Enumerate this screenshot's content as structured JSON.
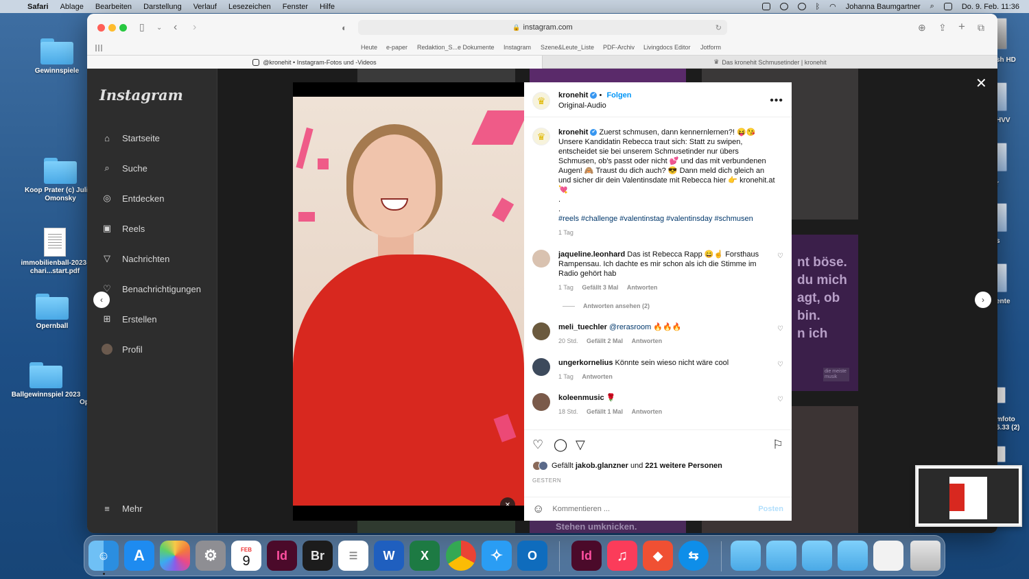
{
  "menubar": {
    "apple": "",
    "items": [
      "Safari",
      "Ablage",
      "Bearbeiten",
      "Darstellung",
      "Verlauf",
      "Lesezeichen",
      "Fenster",
      "Hilfe"
    ],
    "user": "Johanna Baumgartner",
    "clock": "Do. 9. Feb.  11:36"
  },
  "desktop": {
    "icons": [
      "Gewinnspiele",
      "Koop Prater (c) Julian Omonsky",
      "immobilienball-2023-chari...start.pdf",
      "Opernball",
      "Ballgewinnspiel 2023"
    ],
    "side_labels": [
      "sh HD",
      "HVV",
      "r",
      "s",
      "ente",
      "mfoto",
      "6.33 (2)"
    ],
    "partial_label": "Op"
  },
  "browser": {
    "url": "instagram.com",
    "bookmarks": [
      "Heute",
      "e-paper",
      "Redaktion_S...e Dokumente",
      "Instagram",
      "Szene&Leute_Liste",
      "PDF-Archiv",
      "Livingdocs Editor",
      "Jotform"
    ],
    "tab_active": "@kronehit • Instagram-Fotos und -Videos",
    "tab_other": "Das kronehit Schmusetinder | kronehit"
  },
  "instagram": {
    "logo": "Instagram",
    "nav": [
      "Startseite",
      "Suche",
      "Entdecken",
      "Reels",
      "Nachrichten",
      "Benachrichtigungen",
      "Erstellen",
      "Profil"
    ],
    "more": "Mehr",
    "tile_text": "nt böse.\ndu mich\nagt, ob\nbin.\nn ich",
    "tile_bottom_text": "Stehen umknicken.",
    "tile_badge": "die meiste musik"
  },
  "post": {
    "username": "kronehit",
    "verified_mark": "✔",
    "dot_separator": "•",
    "follow": "Folgen",
    "audio": "Original-Audio",
    "more": "•••",
    "caption": "Zuerst schmusen, dann kennernlernen?! 😝😘 Unsere Kandidatin Rebecca traut sich: Statt zu swipen, entscheidet sie bei unserem Schmusetinder nur übers Schmusen, ob's passt oder nicht 💕 und das mit verbundenen Augen! 🙈 Traust du dich auch? 😎 Dann meld dich gleich an und sicher dir dein Valentinsdate mit Rebecca hier 👉 kronehit.at 💘",
    "caption_dots": ".\n.",
    "hashtags": "#reels #challenge #valentinstag #valentinsday #schmusen",
    "time": "1 Tag",
    "comments": [
      {
        "user": "jaqueline.leonhard",
        "text": "Das ist Rebecca Rapp 😄☝️ Forsthaus Rampensau. Ich dachte es mir schon als ich die Stimme im Radio gehört hab",
        "time": "1 Tag",
        "likes": "Gefällt 3 Mal",
        "reply": "Antworten",
        "avatar_color": "#d9c2b0"
      },
      {
        "user": "meli_tuechler",
        "mention": "@rerasroom",
        "text": "🔥🔥🔥",
        "time": "20 Std.",
        "likes": "Gefällt 2 Mal",
        "reply": "Antworten",
        "avatar_color": "#6b5a3e"
      },
      {
        "user": "ungerkornelius",
        "text": "Könnte sein wieso nicht wäre cool",
        "time": "1 Tag",
        "likes": "",
        "reply": "Antworten",
        "avatar_color": "#3d4a5c"
      },
      {
        "user": "koleenmusic",
        "text": "🌹",
        "time": "18 Std.",
        "likes": "Gefällt 1 Mal",
        "reply": "Antworten",
        "avatar_color": "#7a5a4a"
      }
    ],
    "view_replies": "Antworten ansehen (2)",
    "likes_prefix": "Gefällt",
    "likes_user": "jakob.glanzner",
    "likes_mid": "und",
    "likes_count": "221 weitere Personen",
    "date": "GESTERN",
    "comment_placeholder": "Kommentieren ...",
    "post_button": "Posten"
  },
  "dock": {
    "calendar_month": "FEB",
    "calendar_day": "9",
    "id_label": "Id",
    "br_label": "Br",
    "w_label": "W",
    "x_label": "X",
    "o_label": "O"
  }
}
